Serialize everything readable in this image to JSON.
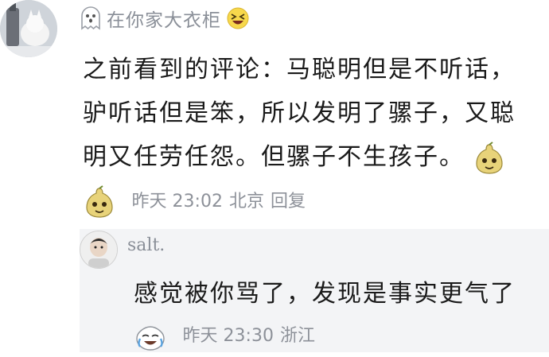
{
  "comment": {
    "username": "在你家大衣柜",
    "username_icons": [
      "ghost-icon",
      "grinning-squint-emoji-icon"
    ],
    "text": "之前看到的评论：马聪明但是不听话，驴听话但是笨，所以发明了骡子，又聪明又任劳任怨。但骡子不生孩子。",
    "emojis": [
      "pear-face-emoji-icon",
      "pear-face-emoji-icon"
    ],
    "time": "昨天 23:02",
    "location": "北京",
    "reply_label": "回复"
  },
  "reply": {
    "username": "salt.",
    "text": "感觉被你骂了，发现是事实更气了",
    "emoji": "crying-laughing-emoji-icon",
    "time": "昨天 23:30",
    "location": "浙江"
  },
  "colors": {
    "meta_gray": "#8d9199",
    "reply_background": "#f3f4f6"
  }
}
